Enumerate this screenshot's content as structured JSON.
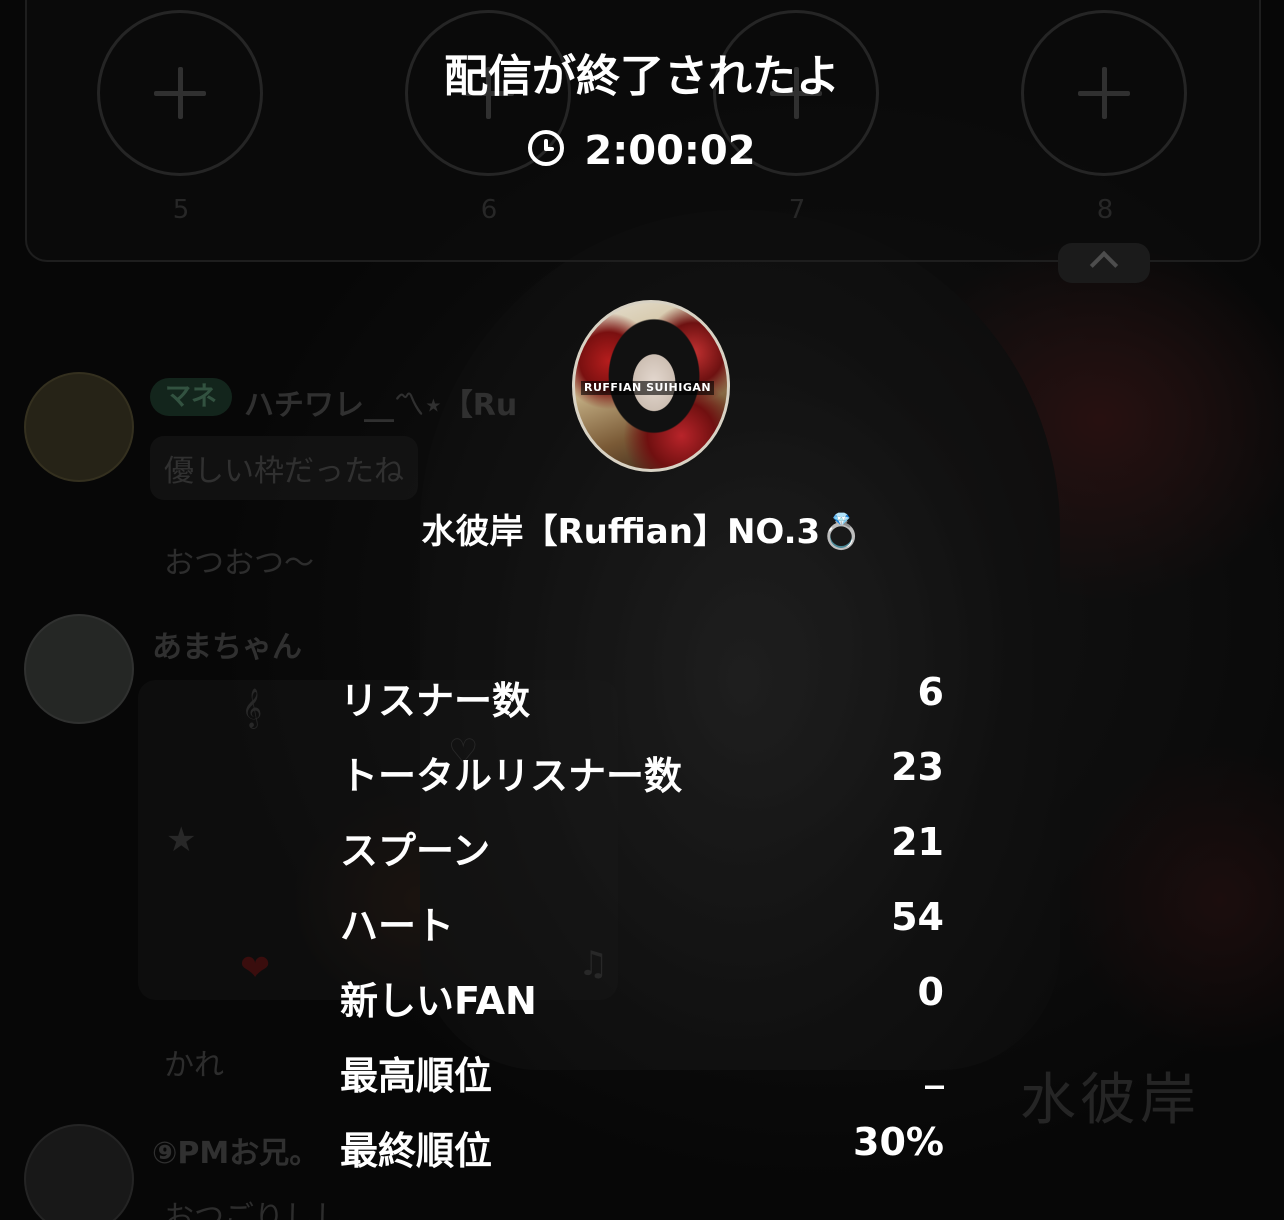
{
  "background": {
    "slot_numbers": [
      "5",
      "6",
      "7",
      "8"
    ],
    "chat": [
      {
        "badge": "マネ",
        "name": "ハチワレ__〽︎⋆【Ru",
        "messages": [
          "優しい枠だったね",
          "おつおつ〜"
        ]
      },
      {
        "name": "あまちゃん",
        "messages": [
          "かれ"
        ]
      },
      {
        "name": "⑨PMお兄。",
        "messages": [
          "おつごりしし"
        ]
      }
    ],
    "watermark": "水彼岸",
    "deco_texts": [
      "𝄞",
      "★",
      "♫",
      "♡"
    ]
  },
  "summary": {
    "title": "配信が終了されたよ",
    "duration": "2:00:02",
    "clock_icon": "clock-icon",
    "host_avatar_text": "RUFFIAN SUIHIGAN",
    "host_name": "水彼岸【Ruffian】NO.3💍"
  },
  "stats": [
    {
      "label": "リスナー数",
      "value": "6"
    },
    {
      "label": "トータルリスナー数",
      "value": "23"
    },
    {
      "label": "スプーン",
      "value": "21"
    },
    {
      "label": "ハート",
      "value": "54"
    },
    {
      "label": "新しいFAN",
      "value": "0"
    },
    {
      "label": "最高順位",
      "value": "_"
    },
    {
      "label": "最終順位",
      "value": "30%"
    }
  ],
  "colors": {
    "background": "#0c0c0c",
    "text": "#ffffff",
    "badge_bg": "#1e3a2c"
  }
}
